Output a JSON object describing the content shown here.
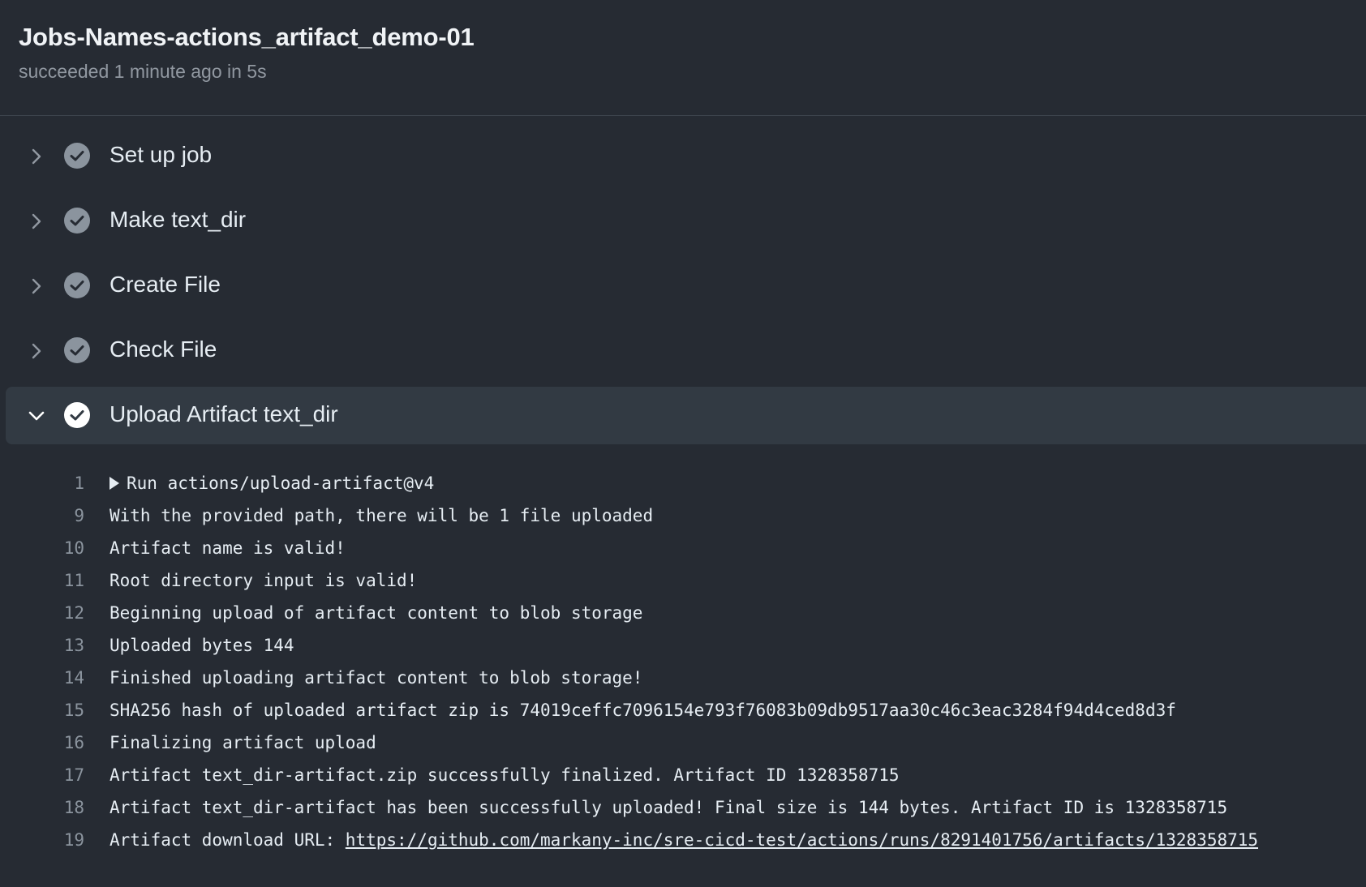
{
  "job": {
    "title": "Jobs-Names-actions_artifact_demo-01",
    "subtitle": "succeeded 1 minute ago in 5s"
  },
  "steps": [
    {
      "label": "Set up job",
      "status": "success",
      "expanded": false
    },
    {
      "label": "Make text_dir",
      "status": "success",
      "expanded": false
    },
    {
      "label": "Create File",
      "status": "success",
      "expanded": false
    },
    {
      "label": "Check File",
      "status": "success",
      "expanded": false
    },
    {
      "label": "Upload Artifact text_dir",
      "status": "success",
      "expanded": true
    }
  ],
  "log": [
    {
      "num": "1",
      "text": "Run actions/upload-artifact@v4"
    },
    {
      "num": "9",
      "text": "With the provided path, there will be 1 file uploaded"
    },
    {
      "num": "10",
      "text": "Artifact name is valid!"
    },
    {
      "num": "11",
      "text": "Root directory input is valid!"
    },
    {
      "num": "12",
      "text": "Beginning upload of artifact content to blob storage"
    },
    {
      "num": "13",
      "text": "Uploaded bytes 144"
    },
    {
      "num": "14",
      "text": "Finished uploading artifact content to blob storage!"
    },
    {
      "num": "15",
      "text": "SHA256 hash of uploaded artifact zip is 74019ceffc7096154e793f76083b09db9517aa30c46c3eac3284f94d4ced8d3f"
    },
    {
      "num": "16",
      "text": "Finalizing artifact upload"
    },
    {
      "num": "17",
      "text": "Artifact text_dir-artifact.zip successfully finalized. Artifact ID 1328358715"
    },
    {
      "num": "18",
      "text": "Artifact text_dir-artifact has been successfully uploaded! Final size is 144 bytes. Artifact ID is 1328358715"
    },
    {
      "num": "19",
      "text": "Artifact download URL: ",
      "link": "https://github.com/markany-inc/sre-cicd-test/actions/runs/8291401756/artifacts/1328358715"
    }
  ],
  "colors": {
    "background": "#262b33",
    "expanded_step_bg": "#323a43",
    "check_collapsed": "#8b949e",
    "check_expanded": "#ffffff",
    "muted_text": "#9198a1"
  },
  "icons": {
    "collapsed": "chevron-right-icon",
    "expanded": "chevron-down-icon",
    "status": "check-circle-icon",
    "log_group": "triangle-right-icon"
  }
}
